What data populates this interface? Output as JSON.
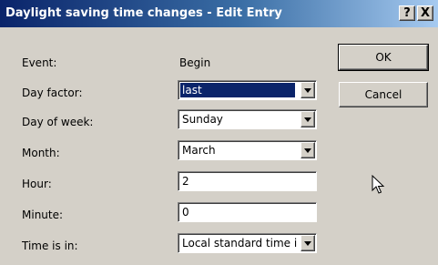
{
  "window": {
    "title": "Daylight saving time changes - Edit Entry",
    "help_label": "?",
    "close_label": "X"
  },
  "form": {
    "event": {
      "label": "Event:",
      "value": "Begin"
    },
    "day_factor": {
      "label": "Day factor:",
      "value": "last"
    },
    "day_of_week": {
      "label": "Day of week:",
      "value": "Sunday"
    },
    "month": {
      "label": "Month:",
      "value": "March"
    },
    "hour": {
      "label": "Hour:",
      "value": "2"
    },
    "minute": {
      "label": "Minute:",
      "value": "0"
    },
    "time_is_in": {
      "label": "Time is in:",
      "value": "Local standard time i"
    }
  },
  "buttons": {
    "ok": "OK",
    "cancel": "Cancel"
  },
  "icons": {
    "dropdown": "chevron-down-icon",
    "cursor": "mouse-pointer-icon"
  },
  "colors": {
    "dialog_bg": "#d4d0c8",
    "titlebar_start": "#0a246a",
    "titlebar_end": "#a6caf0",
    "selection": "#0a246a"
  }
}
